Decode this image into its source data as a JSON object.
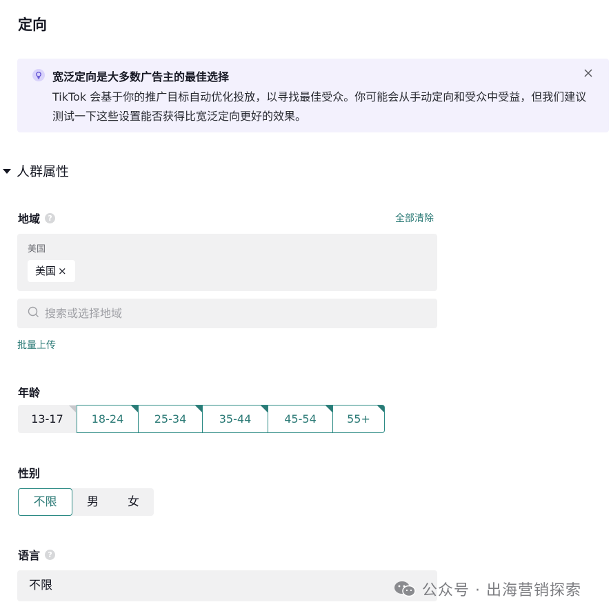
{
  "page": {
    "title": "定向"
  },
  "banner": {
    "title": "宽泛定向是大多数广告主的最佳选择",
    "body": "TikTok 会基于你的推广目标自动优化投放，以寻找最佳受众。你可能会从手动定向和受众中受益，但我们建议测试一下这些设置能否获得比宽泛定向更好的效果。",
    "icon": "lightbulb-icon",
    "close_icon": "close-icon"
  },
  "section": {
    "label": "人群属性"
  },
  "region": {
    "label": "地域",
    "clear_all": "全部清除",
    "group_label": "美国",
    "selected_tag": "美国",
    "remove_glyph": "×",
    "search_placeholder": "搜索或选择地域",
    "bulk_upload": "批量上传"
  },
  "age": {
    "label": "年龄",
    "options": [
      {
        "label": "13-17",
        "selected": false
      },
      {
        "label": "18-24",
        "selected": true
      },
      {
        "label": "25-34",
        "selected": true
      },
      {
        "label": "35-44",
        "selected": true
      },
      {
        "label": "45-54",
        "selected": true
      },
      {
        "label": "55+",
        "selected": true
      }
    ]
  },
  "gender": {
    "label": "性别",
    "options": [
      {
        "label": "不限",
        "selected": true
      },
      {
        "label": "男",
        "selected": false
      },
      {
        "label": "女",
        "selected": false
      }
    ]
  },
  "language": {
    "label": "语言",
    "value": "不限"
  },
  "watermark": {
    "text": "公众号 · 出海营销探索"
  },
  "colors": {
    "accent": "#2b7a76",
    "banner_bg": "#f3f1fd",
    "input_bg": "#f1f1f2"
  }
}
